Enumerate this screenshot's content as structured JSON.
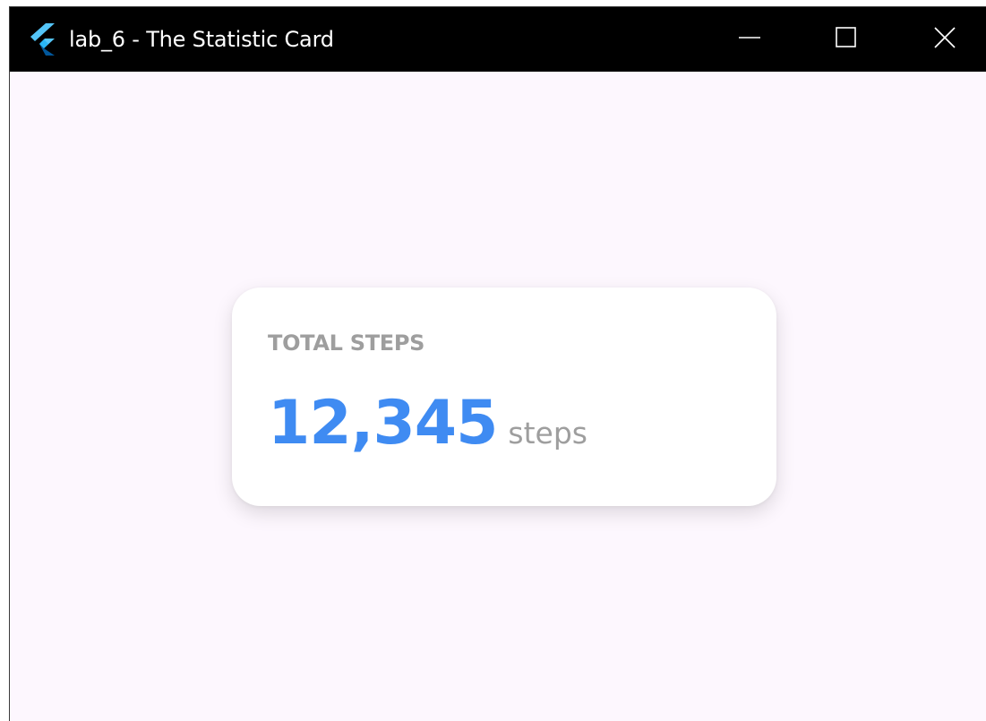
{
  "window": {
    "title": "lab_6 - The Statistic Card",
    "app_icon": "flutter-logo-icon",
    "controls": {
      "minimize_icon": "minimize-icon",
      "maximize_icon": "maximize-icon",
      "close_icon": "close-icon"
    }
  },
  "card": {
    "label": "TOTAL STEPS",
    "value": "12,345",
    "unit": "steps"
  },
  "colors": {
    "titlebar": "#000000",
    "background": "#fdf7fe",
    "card_background": "#ffffff",
    "value": "#3f8bf2",
    "label": "#9e9e9e"
  }
}
